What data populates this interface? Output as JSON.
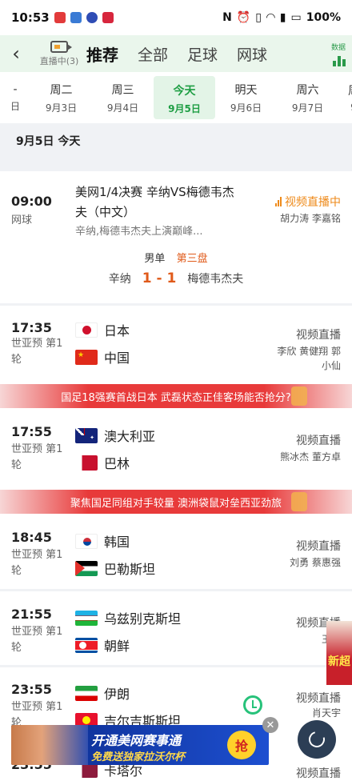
{
  "statusbar": {
    "time": "10:53",
    "battery": "100%"
  },
  "header": {
    "live_label": "直播中(3)",
    "tabs": [
      "推荐",
      "全部",
      "足球",
      "网球"
    ],
    "data_label": "数据"
  },
  "dates": [
    {
      "w": "周二",
      "d": "9月3日"
    },
    {
      "w": "周三",
      "d": "9月4日"
    },
    {
      "w": "今天",
      "d": "9月5日"
    },
    {
      "w": "明天",
      "d": "9月6日"
    },
    {
      "w": "周六",
      "d": "9月7日"
    }
  ],
  "day_header": "9月5日  今天",
  "tennis": {
    "time": "09:00",
    "sport": "网球",
    "title": "美网1/4决赛 辛纳VS梅德韦杰夫（中文）",
    "subtitle": "辛纳,梅德韦杰夫上演巅峰...",
    "live_tag": "视频直播中",
    "commentators": "胡力涛 李嘉铭",
    "stage_event": "男单",
    "stage_set": "第三盘",
    "home": "辛纳",
    "score": "1 - 1",
    "away": "梅德韦杰夫"
  },
  "matches": [
    {
      "time": "17:35",
      "sport": "世亚预 第1轮",
      "home": "日本",
      "away": "中国",
      "broadcast": "视频直播",
      "names": "李欣 黄健翔 郭小仙"
    },
    {
      "time": "17:55",
      "sport": "世亚预 第1轮",
      "home": "澳大利亚",
      "away": "巴林",
      "broadcast": "视频直播",
      "names": "熊冰杰 董方卓"
    },
    {
      "time": "18:45",
      "sport": "世亚预 第1轮",
      "home": "韩国",
      "away": "巴勒斯坦",
      "broadcast": "视频直播",
      "names": "刘勇 蔡惠强"
    },
    {
      "time": "21:55",
      "sport": "世亚预 第1轮",
      "home": "乌兹别克斯坦",
      "away": "朝鲜",
      "broadcast": "视频直播",
      "names": "王立"
    },
    {
      "time": "23:55",
      "sport": "世亚预 第1轮",
      "home": "伊朗",
      "away": "吉尔吉斯斯坦",
      "broadcast": "视频直播",
      "names": "肖天宇"
    },
    {
      "time": "23:55",
      "sport": "",
      "home": "卡塔尔",
      "away": "",
      "broadcast": "视频直播",
      "names": ""
    }
  ],
  "banners": [
    "国足18强赛首战日本 武磊状态正佳客场能否抢分?",
    "聚焦国足同组对手较量 澳洲袋鼠对垒西亚劲旅"
  ],
  "ad": {
    "line1": "开通美网赛事通",
    "line2": "免费送独家拉沃尔杯",
    "button": "抢",
    "side_text": "新超"
  }
}
